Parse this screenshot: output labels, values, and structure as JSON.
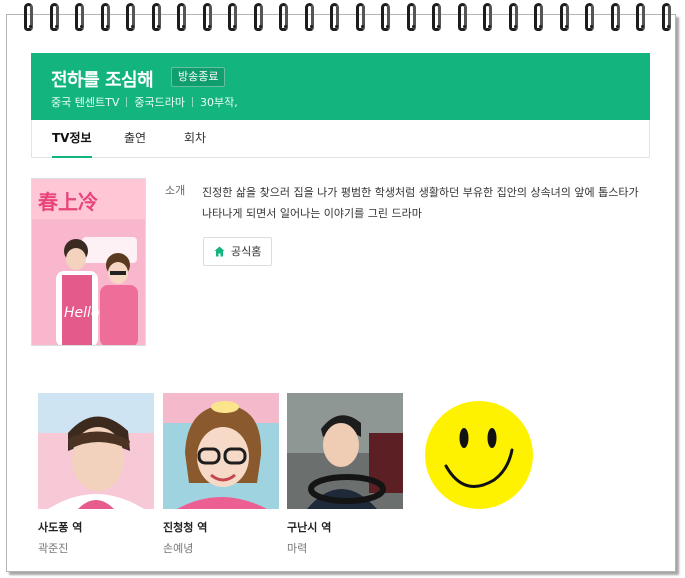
{
  "show": {
    "title": "전하를 조심해",
    "status_badge": "방송종료",
    "meta": [
      "중국 텐센트TV",
      "중국드라마",
      "30부작,"
    ]
  },
  "tabs": [
    {
      "label": "TV정보",
      "active": true
    },
    {
      "label": "출연",
      "active": false
    },
    {
      "label": "회차",
      "active": false
    }
  ],
  "intro": {
    "label": "소개",
    "text": "진정한 삶을 찾으러 집을 나가 평범한 학생처럼 생활하던 부유한 집안의 상속녀의 앞에 톱스타가 나타나게 되면서 일어나는 이야기를 그린 드라마"
  },
  "home_button": {
    "label": "공식홈",
    "icon": "home-icon"
  },
  "cast": [
    {
      "role": "사도퐁 역",
      "actor": "곽준진"
    },
    {
      "role": "진청청 역",
      "actor": "손예녕"
    },
    {
      "role": "구난시 역",
      "actor": "마력"
    }
  ],
  "colors": {
    "brand": "#14b47f",
    "smiley": "#fff200"
  }
}
